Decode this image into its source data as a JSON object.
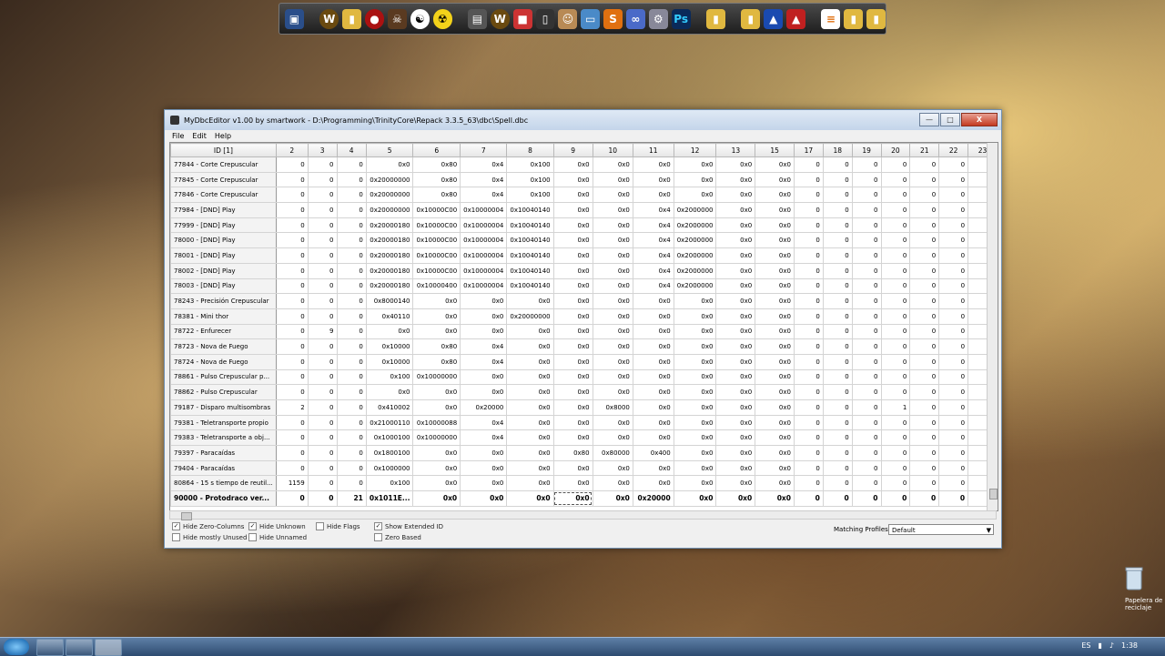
{
  "window": {
    "title": "MyDbcEditor v1.00 by smartwork - D:\\Programming\\TrinityCore\\Repack 3.3.5_63\\dbc\\Spell.dbc",
    "minimize": "—",
    "maximize": "□",
    "close": "X"
  },
  "menu": [
    "File",
    "Edit",
    "Help"
  ],
  "columns": [
    "ID [1]",
    "2",
    "3",
    "4",
    "5",
    "6",
    "7",
    "8",
    "9",
    "10",
    "11",
    "12",
    "13",
    "15",
    "17",
    "18",
    "19",
    "20",
    "21",
    "22",
    "23"
  ],
  "rows": [
    [
      "77844 - Corte Crepuscular",
      "0",
      "0",
      "0",
      "0x0",
      "0x80",
      "0x4",
      "0x100",
      "0x0",
      "0x0",
      "0x0",
      "0x0",
      "0x0",
      "0x0",
      "0",
      "0",
      "0",
      "0",
      "0",
      "0",
      "0"
    ],
    [
      "77845 - Corte Crepuscular",
      "0",
      "0",
      "0",
      "0x20000000",
      "0x80",
      "0x4",
      "0x100",
      "0x0",
      "0x0",
      "0x0",
      "0x0",
      "0x0",
      "0x0",
      "0",
      "0",
      "0",
      "0",
      "0",
      "0",
      "0"
    ],
    [
      "77846 - Corte Crepuscular",
      "0",
      "0",
      "0",
      "0x20000000",
      "0x80",
      "0x4",
      "0x100",
      "0x0",
      "0x0",
      "0x0",
      "0x0",
      "0x0",
      "0x0",
      "0",
      "0",
      "0",
      "0",
      "0",
      "0",
      "0"
    ],
    [
      "77984 - [DND] Play",
      "0",
      "0",
      "0",
      "0x20000000",
      "0x10000C00",
      "0x10000004",
      "0x10040140",
      "0x0",
      "0x0",
      "0x4",
      "0x2000000",
      "0x0",
      "0x0",
      "0",
      "0",
      "0",
      "0",
      "0",
      "0",
      "0"
    ],
    [
      "77999 - [DND] Play",
      "0",
      "0",
      "0",
      "0x20000180",
      "0x10000C00",
      "0x10000004",
      "0x10040140",
      "0x0",
      "0x0",
      "0x4",
      "0x2000000",
      "0x0",
      "0x0",
      "0",
      "0",
      "0",
      "0",
      "0",
      "0",
      "0"
    ],
    [
      "78000 - [DND] Play",
      "0",
      "0",
      "0",
      "0x20000180",
      "0x10000C00",
      "0x10000004",
      "0x10040140",
      "0x0",
      "0x0",
      "0x4",
      "0x2000000",
      "0x0",
      "0x0",
      "0",
      "0",
      "0",
      "0",
      "0",
      "0",
      "0"
    ],
    [
      "78001 - [DND] Play",
      "0",
      "0",
      "0",
      "0x20000180",
      "0x10000C00",
      "0x10000004",
      "0x10040140",
      "0x0",
      "0x0",
      "0x4",
      "0x2000000",
      "0x0",
      "0x0",
      "0",
      "0",
      "0",
      "0",
      "0",
      "0",
      "0"
    ],
    [
      "78002 - [DND] Play",
      "0",
      "0",
      "0",
      "0x20000180",
      "0x10000C00",
      "0x10000004",
      "0x10040140",
      "0x0",
      "0x0",
      "0x4",
      "0x2000000",
      "0x0",
      "0x0",
      "0",
      "0",
      "0",
      "0",
      "0",
      "0",
      "0"
    ],
    [
      "78003 - [DND] Play",
      "0",
      "0",
      "0",
      "0x20000180",
      "0x10000400",
      "0x10000004",
      "0x10040140",
      "0x0",
      "0x0",
      "0x4",
      "0x2000000",
      "0x0",
      "0x0",
      "0",
      "0",
      "0",
      "0",
      "0",
      "0",
      "0"
    ],
    [
      "78243 - Precisión Crepuscular",
      "0",
      "0",
      "0",
      "0x8000140",
      "0x0",
      "0x0",
      "0x0",
      "0x0",
      "0x0",
      "0x0",
      "0x0",
      "0x0",
      "0x0",
      "0",
      "0",
      "0",
      "0",
      "0",
      "0",
      "0"
    ],
    [
      "78381 - Mini thor",
      "0",
      "0",
      "0",
      "0x40110",
      "0x0",
      "0x0",
      "0x20000000",
      "0x0",
      "0x0",
      "0x0",
      "0x0",
      "0x0",
      "0x0",
      "0",
      "0",
      "0",
      "0",
      "0",
      "0",
      "0"
    ],
    [
      "78722 - Enfurecer",
      "0",
      "9",
      "0",
      "0x0",
      "0x0",
      "0x0",
      "0x0",
      "0x0",
      "0x0",
      "0x0",
      "0x0",
      "0x0",
      "0x0",
      "0",
      "0",
      "0",
      "0",
      "0",
      "0",
      "0"
    ],
    [
      "78723 - Nova de Fuego",
      "0",
      "0",
      "0",
      "0x10000",
      "0x80",
      "0x4",
      "0x0",
      "0x0",
      "0x0",
      "0x0",
      "0x0",
      "0x0",
      "0x0",
      "0",
      "0",
      "0",
      "0",
      "0",
      "0",
      "0"
    ],
    [
      "78724 - Nova de Fuego",
      "0",
      "0",
      "0",
      "0x10000",
      "0x80",
      "0x4",
      "0x0",
      "0x0",
      "0x0",
      "0x0",
      "0x0",
      "0x0",
      "0x0",
      "0",
      "0",
      "0",
      "0",
      "0",
      "0",
      "0"
    ],
    [
      "78861 - Pulso Crepuscular p...",
      "0",
      "0",
      "0",
      "0x100",
      "0x10000000",
      "0x0",
      "0x0",
      "0x0",
      "0x0",
      "0x0",
      "0x0",
      "0x0",
      "0x0",
      "0",
      "0",
      "0",
      "0",
      "0",
      "0",
      "0"
    ],
    [
      "78862 - Pulso Crepuscular",
      "0",
      "0",
      "0",
      "0x0",
      "0x0",
      "0x0",
      "0x0",
      "0x0",
      "0x0",
      "0x0",
      "0x0",
      "0x0",
      "0x0",
      "0",
      "0",
      "0",
      "0",
      "0",
      "0",
      "0"
    ],
    [
      "79187 - Disparo multisombras",
      "2",
      "0",
      "0",
      "0x410002",
      "0x0",
      "0x20000",
      "0x0",
      "0x0",
      "0x8000",
      "0x0",
      "0x0",
      "0x0",
      "0x0",
      "0",
      "0",
      "0",
      "1",
      "0",
      "0",
      "0"
    ],
    [
      "79381 - Teletransporte propio",
      "0",
      "0",
      "0",
      "0x21000110",
      "0x10000088",
      "0x4",
      "0x0",
      "0x0",
      "0x0",
      "0x0",
      "0x0",
      "0x0",
      "0x0",
      "0",
      "0",
      "0",
      "0",
      "0",
      "0",
      "0"
    ],
    [
      "79383 - Teletransporte a obj...",
      "0",
      "0",
      "0",
      "0x1000100",
      "0x10000000",
      "0x4",
      "0x0",
      "0x0",
      "0x0",
      "0x0",
      "0x0",
      "0x0",
      "0x0",
      "0",
      "0",
      "0",
      "0",
      "0",
      "0",
      "0"
    ],
    [
      "79397 - Paracaídas",
      "0",
      "0",
      "0",
      "0x1800100",
      "0x0",
      "0x0",
      "0x0",
      "0x80",
      "0x80000",
      "0x400",
      "0x0",
      "0x0",
      "0x0",
      "0",
      "0",
      "0",
      "0",
      "0",
      "0",
      "0"
    ],
    [
      "79404 - Paracaídas",
      "0",
      "0",
      "0",
      "0x1000000",
      "0x0",
      "0x0",
      "0x0",
      "0x0",
      "0x0",
      "0x0",
      "0x0",
      "0x0",
      "0x0",
      "0",
      "0",
      "0",
      "0",
      "0",
      "0",
      "0"
    ],
    [
      "80864 - 15 s tiempo de reutil...",
      "1159",
      "0",
      "0",
      "0x100",
      "0x0",
      "0x0",
      "0x0",
      "0x0",
      "0x0",
      "0x0",
      "0x0",
      "0x0",
      "0x0",
      "0",
      "0",
      "0",
      "0",
      "0",
      "0",
      "0"
    ],
    [
      "90000 - Protodraco ver...",
      "0",
      "0",
      "21",
      "0x1011E...",
      "0x0",
      "0x0",
      "0x0",
      "0x0",
      "0x0",
      "0x20000",
      "0x0",
      "0x0",
      "0x0",
      "0",
      "0",
      "0",
      "0",
      "0",
      "0",
      "0"
    ]
  ],
  "options": {
    "hide_zero_columns": "Hide Zero-Columns",
    "hide_mostly_unused": "Hide mostly Unused",
    "hide_unknown": "Hide Unknown",
    "hide_unnamed": "Hide Unnamed",
    "hide_flags": "Hide Flags",
    "show_extended_id": "Show Extended ID",
    "zero_based": "Zero Based",
    "matching_profiles_label": "Matching Profiles:",
    "matching_profiles_value": "Default"
  },
  "desktop": {
    "recycle_label": "Papelera de reciclaje"
  },
  "taskbar": {
    "lang": "ES",
    "clock": "1:38"
  }
}
